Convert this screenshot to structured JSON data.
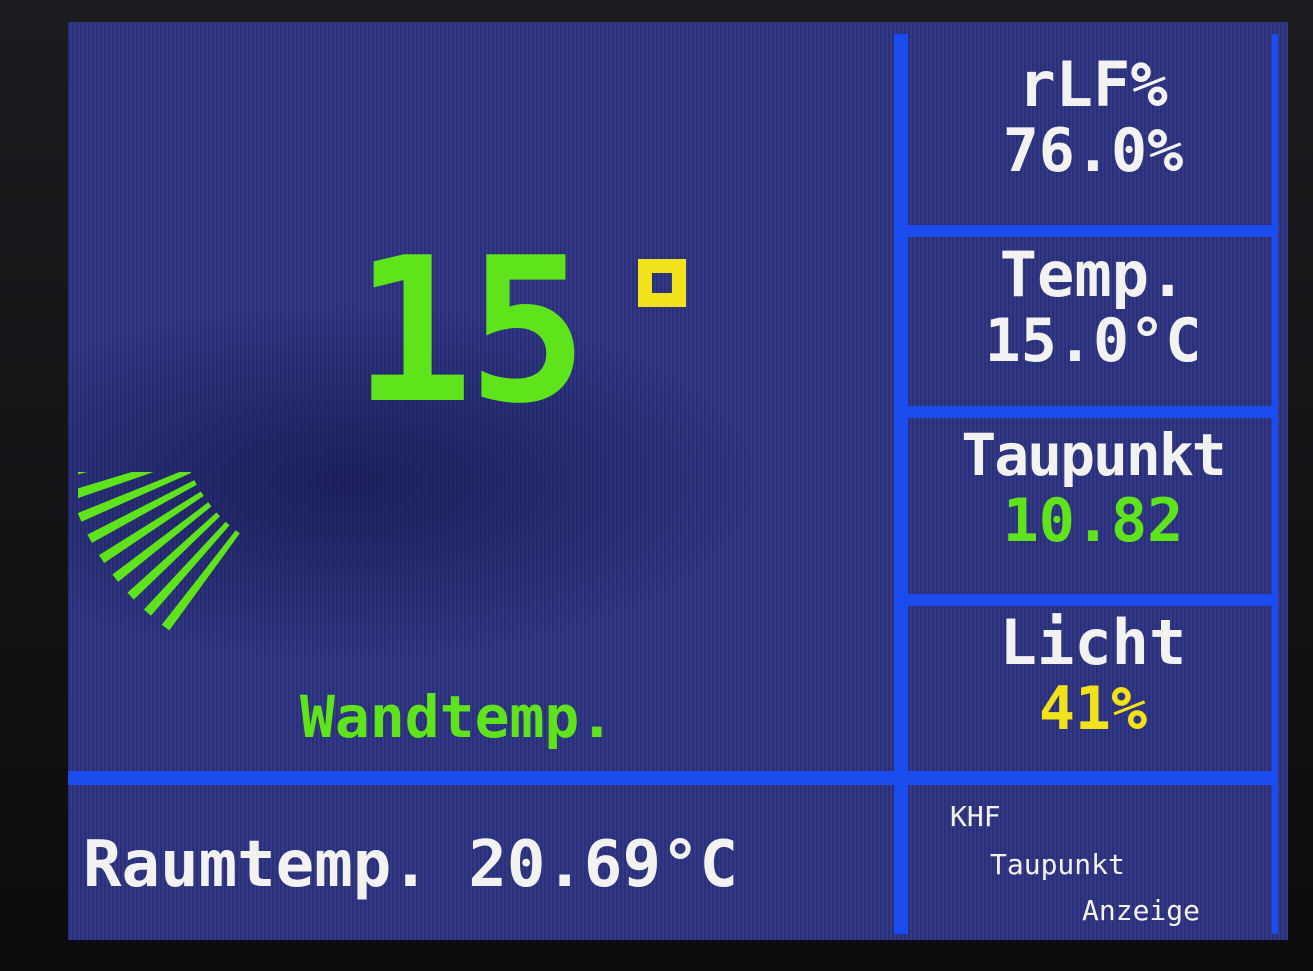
{
  "main": {
    "wall_temp_value": "15",
    "wall_temp_label": "Wandtemp.",
    "gauge_level": 0.5,
    "room_temp_text": "Raumtemp. 20.69°C"
  },
  "panels": {
    "rlf": {
      "label": "rLF%",
      "value": "76.0%"
    },
    "temp": {
      "label": "Temp.",
      "value": "15.0°C"
    },
    "taupunkt": {
      "label": "Taupunkt",
      "value": "10.82"
    },
    "licht": {
      "label": "Licht",
      "value": "41%"
    }
  },
  "footer": {
    "line1": "KHF",
    "line2": "Taupunkt",
    "line3": "Anzeige"
  },
  "colors": {
    "background": "#2f3585",
    "divider": "#1a4cf0",
    "green": "#5fe31a",
    "yellow": "#f2e21a",
    "white": "#f2f2f2"
  }
}
